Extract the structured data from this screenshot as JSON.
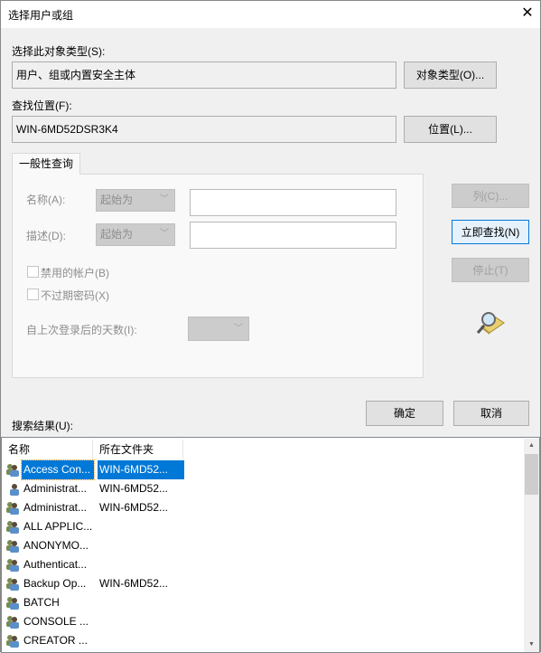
{
  "window": {
    "title": "选择用户或组",
    "close": "✕"
  },
  "object_type": {
    "label": "选择此对象类型(S):",
    "value": "用户、组或内置安全主体",
    "button": "对象类型(O)..."
  },
  "location": {
    "label": "查找位置(F):",
    "value": "WIN-6MD52DSR3K4",
    "button": "位置(L)..."
  },
  "tab": {
    "label": "一般性查询"
  },
  "query": {
    "name_label": "名称(A):",
    "name_mode": "起始为",
    "name_value": "",
    "desc_label": "描述(D):",
    "desc_mode": "起始为",
    "desc_value": "",
    "disabled_accounts": {
      "label": "禁用的帐户(B)",
      "checked": false
    },
    "no_expire": {
      "label": "不过期密码(X)",
      "checked": false
    },
    "days_label": "自上次登录后的天数(I):",
    "days_value": ""
  },
  "buttons": {
    "columns": "列(C)...",
    "find_now": "立即查找(N)",
    "stop": "停止(T)",
    "ok": "确定",
    "cancel": "取消"
  },
  "results": {
    "label": "搜索结果(U):",
    "columns": [
      "名称",
      "所在文件夹"
    ],
    "rows": [
      {
        "name": "Access Con...",
        "folder": "WIN-6MD52...",
        "icon": "group",
        "selected": true
      },
      {
        "name": "Administrat...",
        "folder": "WIN-6MD52...",
        "icon": "user"
      },
      {
        "name": "Administrat...",
        "folder": "WIN-6MD52...",
        "icon": "group"
      },
      {
        "name": "ALL APPLIC...",
        "folder": "",
        "icon": "group"
      },
      {
        "name": "ANONYMO...",
        "folder": "",
        "icon": "group"
      },
      {
        "name": "Authenticat...",
        "folder": "",
        "icon": "group"
      },
      {
        "name": "Backup Op...",
        "folder": "WIN-6MD52...",
        "icon": "group"
      },
      {
        "name": "BATCH",
        "folder": "",
        "icon": "group"
      },
      {
        "name": "CONSOLE ...",
        "folder": "",
        "icon": "group"
      },
      {
        "name": "CREATOR ...",
        "folder": "",
        "icon": "group"
      }
    ]
  }
}
